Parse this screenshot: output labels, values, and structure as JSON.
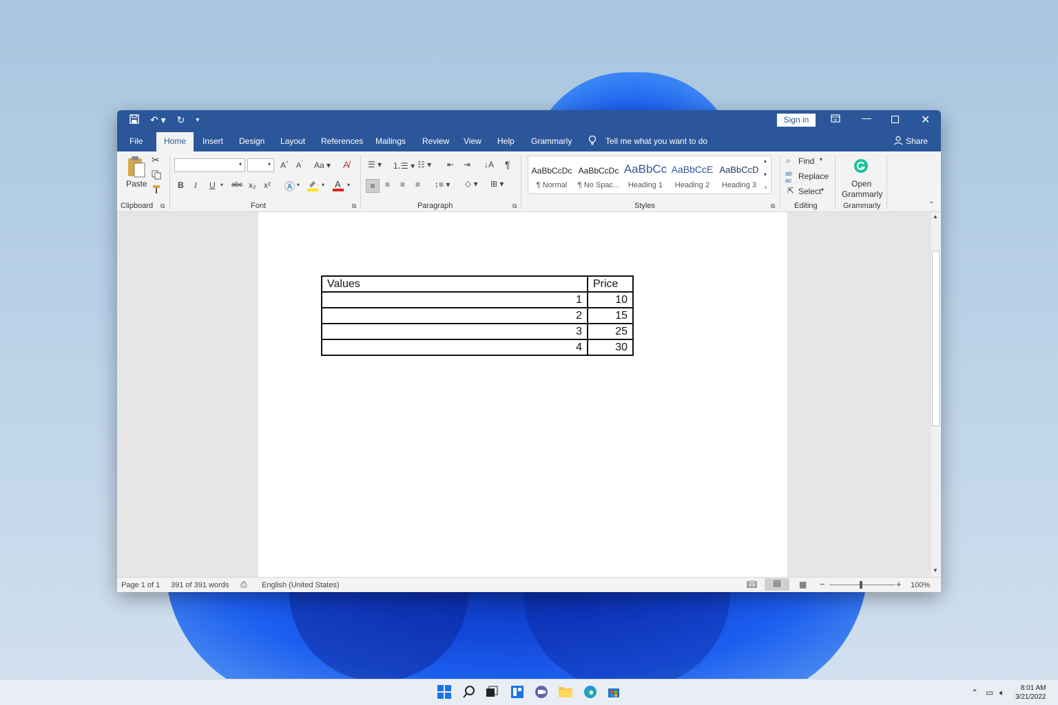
{
  "titlebar": {
    "sign_in": "Sign in"
  },
  "tabs": [
    "File",
    "Home",
    "Insert",
    "Design",
    "Layout",
    "References",
    "Mailings",
    "Review",
    "View",
    "Help",
    "Grammarly"
  ],
  "tell_me": "Tell me what you want to do",
  "share": "Share",
  "ribbon": {
    "paste": "Paste",
    "groups": {
      "clipboard": "Clipboard",
      "font": "Font",
      "paragraph": "Paragraph",
      "styles": "Styles",
      "editing": "Editing",
      "grammarly": "Grammarly"
    },
    "font_buttons": {
      "bold": "B",
      "italic": "I",
      "underline": "U",
      "strike": "abc",
      "sub": "x₂",
      "sup": "x²",
      "case": "Aa"
    },
    "styles": [
      {
        "sample": "AaBbCcDc",
        "name": "¶ Normal"
      },
      {
        "sample": "AaBbCcDc",
        "name": "¶ No Spac..."
      },
      {
        "sample": "AaBbCc",
        "name": "Heading 1"
      },
      {
        "sample": "AaBbCcE",
        "name": "Heading 2"
      },
      {
        "sample": "AaBbCcD",
        "name": "Heading 3"
      }
    ],
    "find": "Find",
    "replace": "Replace",
    "select": "Select",
    "open_grammarly_1": "Open",
    "open_grammarly_2": "Grammarly"
  },
  "document": {
    "table": {
      "headers": [
        "Values",
        "Price"
      ],
      "rows": [
        [
          "1",
          "10"
        ],
        [
          "2",
          "15"
        ],
        [
          "3",
          "25"
        ],
        [
          "4",
          "30"
        ]
      ]
    }
  },
  "status": {
    "page": "Page 1 of 1",
    "words": "391 of 391 words",
    "language": "English (United States)",
    "zoom": "100%"
  },
  "taskbar": {
    "time": "8:01 AM",
    "date": "3/21/2022"
  },
  "colors": {
    "word_blue": "#2b579a",
    "grammarly_green": "#15c39a"
  }
}
